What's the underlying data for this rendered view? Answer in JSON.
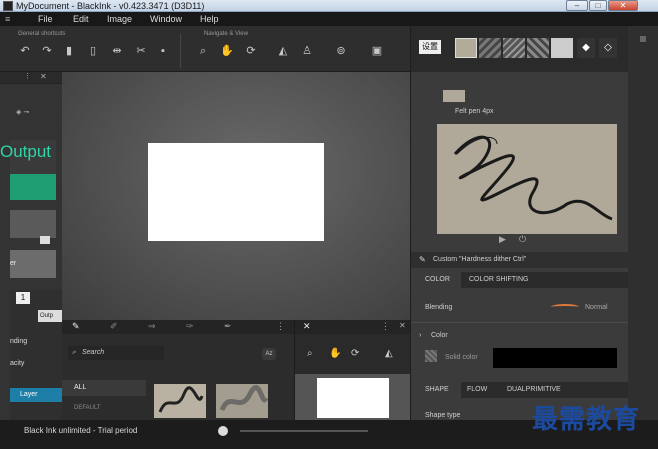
{
  "window": {
    "title": "MyDocument - BlackInk - v0.423.3471 (D3D11)",
    "buttons": [
      "–",
      "□",
      "✕"
    ]
  },
  "menu": [
    "File",
    "Edit",
    "Image",
    "Window",
    "Help"
  ],
  "toolbar": {
    "groups": [
      "General shortcuts",
      "Navigate & View"
    ]
  },
  "left_panel": {
    "output_label": "Output",
    "layer_label": "er",
    "blending": "nding",
    "opacity": "acity",
    "layer": "Layer",
    "tab": "1",
    "field": "Outp"
  },
  "bottom_panel": {
    "search_placeholder": "Search",
    "az": "Az",
    "filters": [
      "ALL",
      "DEFAULT"
    ]
  },
  "right_panel": {
    "brush_name": "Felt pen 4px",
    "custom": "Custom \"Hardness dither Ctrl\"",
    "tabs1": [
      "COLOR",
      "COLOR SHIFTING"
    ],
    "blending": "Blending",
    "blend_mode": "Normal",
    "color_section": "Color",
    "solid_color": "Solid color",
    "tabs2": [
      "SHAPE",
      "FLOW",
      "DUALPRIMITIVE"
    ],
    "shape_type": "Shape type",
    "cjk_label": "设置"
  },
  "status": {
    "text": "Black Ink unlimited - Trial period"
  },
  "watermark": "最需教育"
}
